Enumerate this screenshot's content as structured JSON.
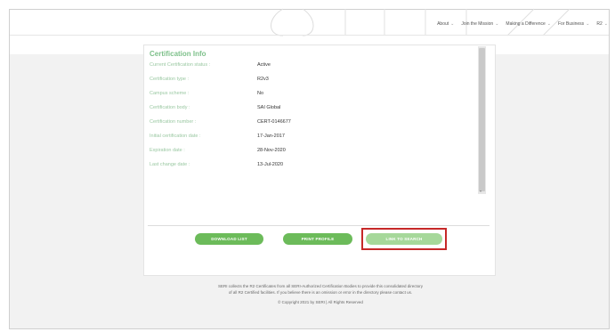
{
  "nav": {
    "items": [
      {
        "label": "About"
      },
      {
        "label": "Join the Mission"
      },
      {
        "label": "Making a Difference"
      },
      {
        "label": "For Business"
      },
      {
        "label": "R2"
      }
    ]
  },
  "certification": {
    "title": "Certification Info",
    "rows": [
      {
        "label": "Current Certification status :",
        "value": "Active"
      },
      {
        "label": "Certification type :",
        "value": "R2v3"
      },
      {
        "label": "Campus scheme :",
        "value": "No"
      },
      {
        "label": "Certification body :",
        "value": "SAI Global"
      },
      {
        "label": "Certification number :",
        "value": "CERT-0146677"
      },
      {
        "label": "Initial certification date :",
        "value": "17-Jan-2017"
      },
      {
        "label": "Expiration date :",
        "value": "28-Nov-2020"
      },
      {
        "label": "Last change date :",
        "value": "13-Jul-2020"
      }
    ]
  },
  "buttons": {
    "download": "DOWNLOAD LIST",
    "print": "PRINT PROFILE",
    "back": "LINK TO SEARCH"
  },
  "footer": {
    "line1": "SERI collects the R2 Certificates from all SERI-Authorized Certification Bodies to provide this consolidated directory",
    "line2": "of all R2 Certified facilities. If you believe there is an omission or error in the directory please contact us.",
    "copyright": "© Copyright 2021 by SERI | All Rights Reserved"
  },
  "colors": {
    "accent_green": "#6cbb5a",
    "label_green": "#9ac8a2",
    "highlight_red": "#c62828"
  }
}
